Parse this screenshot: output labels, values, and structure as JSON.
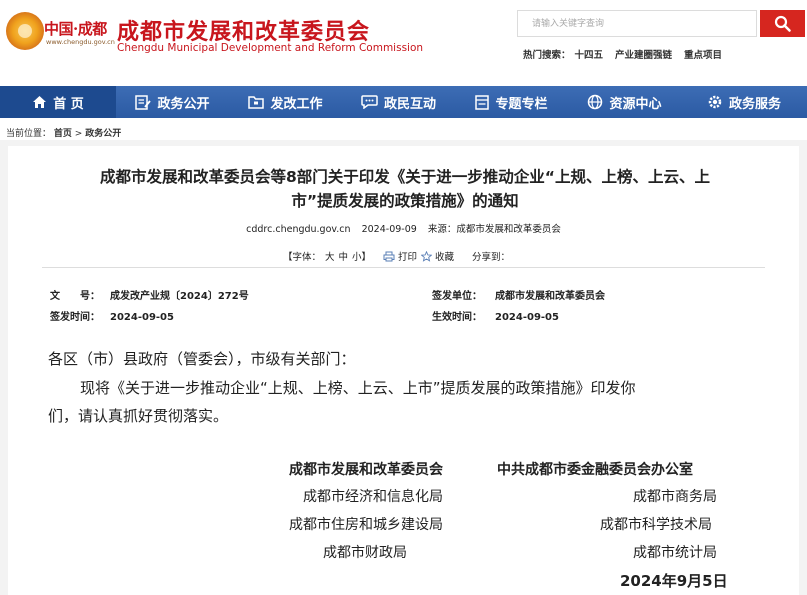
{
  "header": {
    "logo_text": "中国·成都",
    "logo_url": "www.chengdu.gov.cn",
    "title_cn": "成都市发展和改革委员会",
    "title_en": "Chengdu Municipal Development and Reform Commission",
    "search_placeholder": "请输入关键字查询",
    "hot_label": "热门搜索：",
    "hot_items": [
      "十四五",
      "产业建圈强链",
      "重点项目"
    ]
  },
  "nav": {
    "items": [
      "首 页",
      "政务公开",
      "发改工作",
      "政民互动",
      "专题专栏",
      "资源中心",
      "政务服务"
    ]
  },
  "breadcrumb": {
    "label": "当前位置：",
    "home": "首页",
    "sep": ">",
    "current": "政务公开"
  },
  "article": {
    "title_line1": "成都市发展和改革委员会等8部门关于印发《关于进一步推动企业“上规、上榜、上云、上",
    "title_line2": "市”提质发展的政策措施》的通知",
    "site": "cddrc.chengdu.gov.cn",
    "date": "2024-09-09",
    "source_label": "来源：",
    "source": "成都市发展和改革委员会",
    "font_label": "【字体：",
    "font_big": "大",
    "font_mid": "中",
    "font_small": "小】",
    "print": "打印",
    "favorite": "收藏",
    "share": "分享到：",
    "doc_no_label": "文　　号：",
    "doc_no": "成发改产业规〔2024〕272号",
    "issuer_label": "签发单位：",
    "issuer": "成都市发展和改革委员会",
    "issue_date_label": "签发时间：",
    "issue_date": "2024-09-05",
    "effective_label": "生效时间：",
    "effective_date": "2024-09-05",
    "salutation": "各区（市）县政府（管委会），市级有关部门：",
    "body_line1": "现将《关于进一步推动企业“上规、上榜、上云、上市”提质发展的政策措施》印发你",
    "body_line2": "们，请认真抓好贯彻落实。",
    "signers_left": [
      "成都市发展和改革委员会",
      "成都市经济和信息化局",
      "成都市住房和城乡建设局",
      "成都市财政局"
    ],
    "signers_right": [
      "中共成都市委金融委员会办公室",
      "成都市商务局",
      "成都市科学技术局",
      "成都市统计局"
    ],
    "sign_date": "2024年9月5日"
  }
}
